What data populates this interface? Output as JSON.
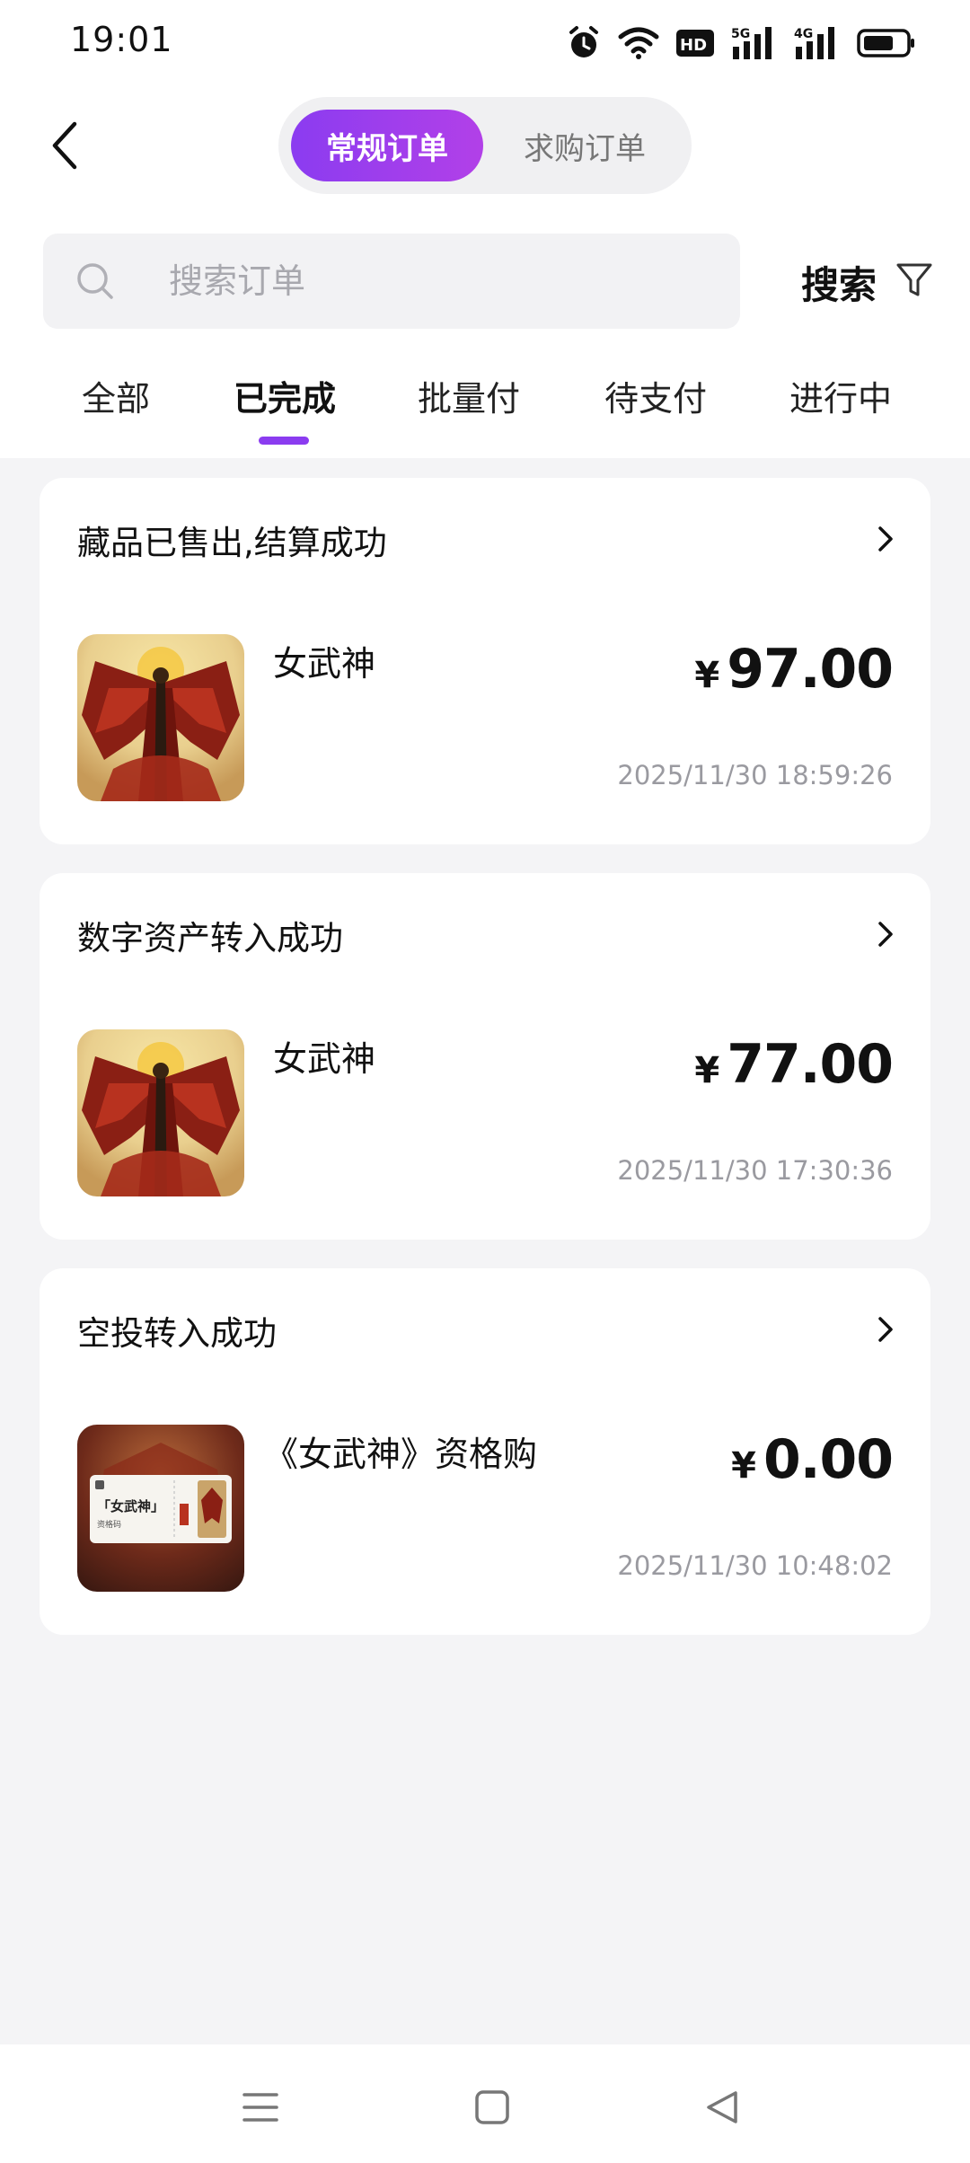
{
  "status_bar": {
    "time": "19:01",
    "icons": [
      "alarm-icon",
      "wifi-icon",
      "hd-icon",
      "signal-5g-icon",
      "signal-4g-icon",
      "battery-icon"
    ],
    "network_labels": [
      "HD",
      "5G",
      "4G"
    ]
  },
  "header": {
    "back_icon": "chevron-left-icon",
    "segments": [
      {
        "label": "常规订单",
        "active": true
      },
      {
        "label": "求购订单",
        "active": false
      }
    ]
  },
  "search": {
    "placeholder": "搜索订单",
    "value": "",
    "button_label": "搜索",
    "filter_icon": "filter-icon"
  },
  "tabs": [
    {
      "label": "全部",
      "active": false
    },
    {
      "label": "已完成",
      "active": true
    },
    {
      "label": "批量付",
      "active": false
    },
    {
      "label": "待支付",
      "active": false
    },
    {
      "label": "进行中",
      "active": false
    }
  ],
  "orders": [
    {
      "status": "藏品已售出,结算成功",
      "name": "女武神",
      "currency": "¥",
      "price": "97.00",
      "time": "2025/11/30 18:59:26"
    },
    {
      "status": "数字资产转入成功",
      "name": "女武神",
      "currency": "¥",
      "price": "77.00",
      "time": "2025/11/30 17:30:36"
    },
    {
      "status": "空投转入成功",
      "name": "《女武神》资格购",
      "currency": "¥",
      "price": "0.00",
      "time": "2025/11/30 10:48:02",
      "ticket_text": "「女武神」",
      "ticket_sub": "资格码"
    }
  ],
  "bottom_nav": {
    "icons": [
      "menu-icon",
      "home-square-icon",
      "back-triangle-icon"
    ]
  },
  "colors": {
    "accent": "#8b3cf0",
    "background": "#f4f4f6",
    "muted_text": "#9a9aa0"
  }
}
